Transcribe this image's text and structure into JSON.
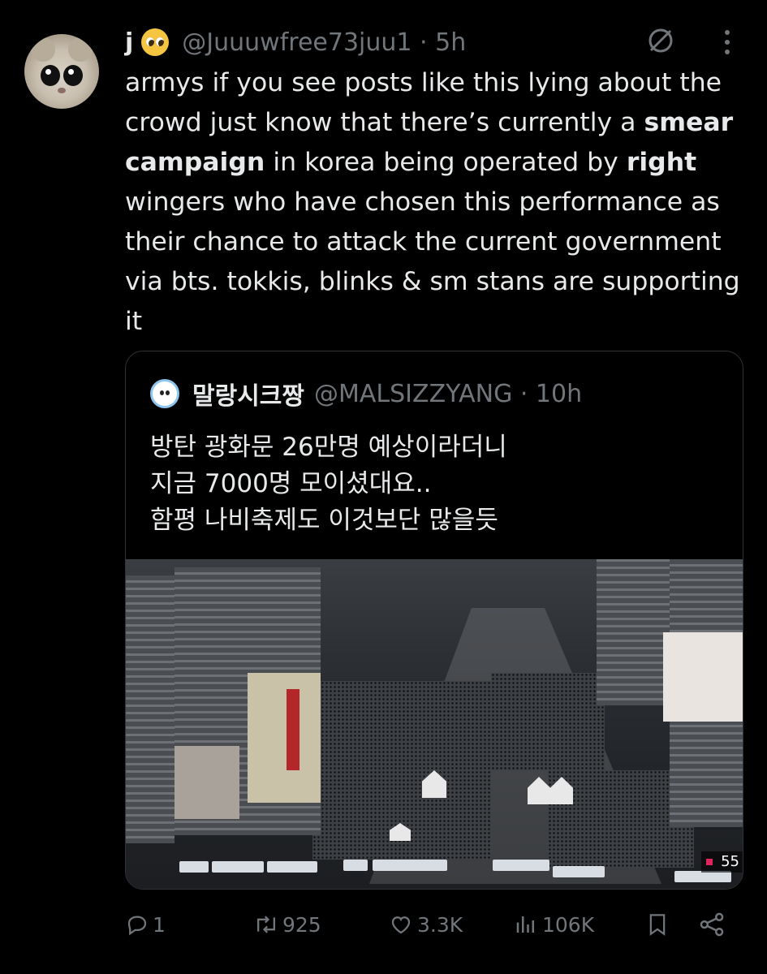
{
  "tweet": {
    "display_name": "j",
    "handle_time": "@Juuuwfree73juu1 · 5h",
    "text_parts": [
      "armys if you see posts like this lying about the crowd just know that there’s currently a ",
      "smear campaign",
      " in korea being operated by ",
      "right",
      " wingers who have chosen this performance as their chance to attack the current government via bts. tokkis, blinks & sm stans are supporting it"
    ]
  },
  "quote": {
    "display_name": "말랑시크짱",
    "handle_time": "@MALSIZZYANG · 10h",
    "lines": [
      "방탄 광화문 26만명 예상이라더니",
      "지금 7000명 모이셨대요..",
      "함평 나비축제도 이것보단 많을듯"
    ],
    "viewer_count": "55"
  },
  "actions": {
    "replies": "1",
    "reposts": "925",
    "likes": "3.3K",
    "views": "106K"
  },
  "colors": {
    "background": "#000000",
    "text": "#e7e9ea",
    "muted": "#71767b",
    "border": "#2f3336"
  }
}
